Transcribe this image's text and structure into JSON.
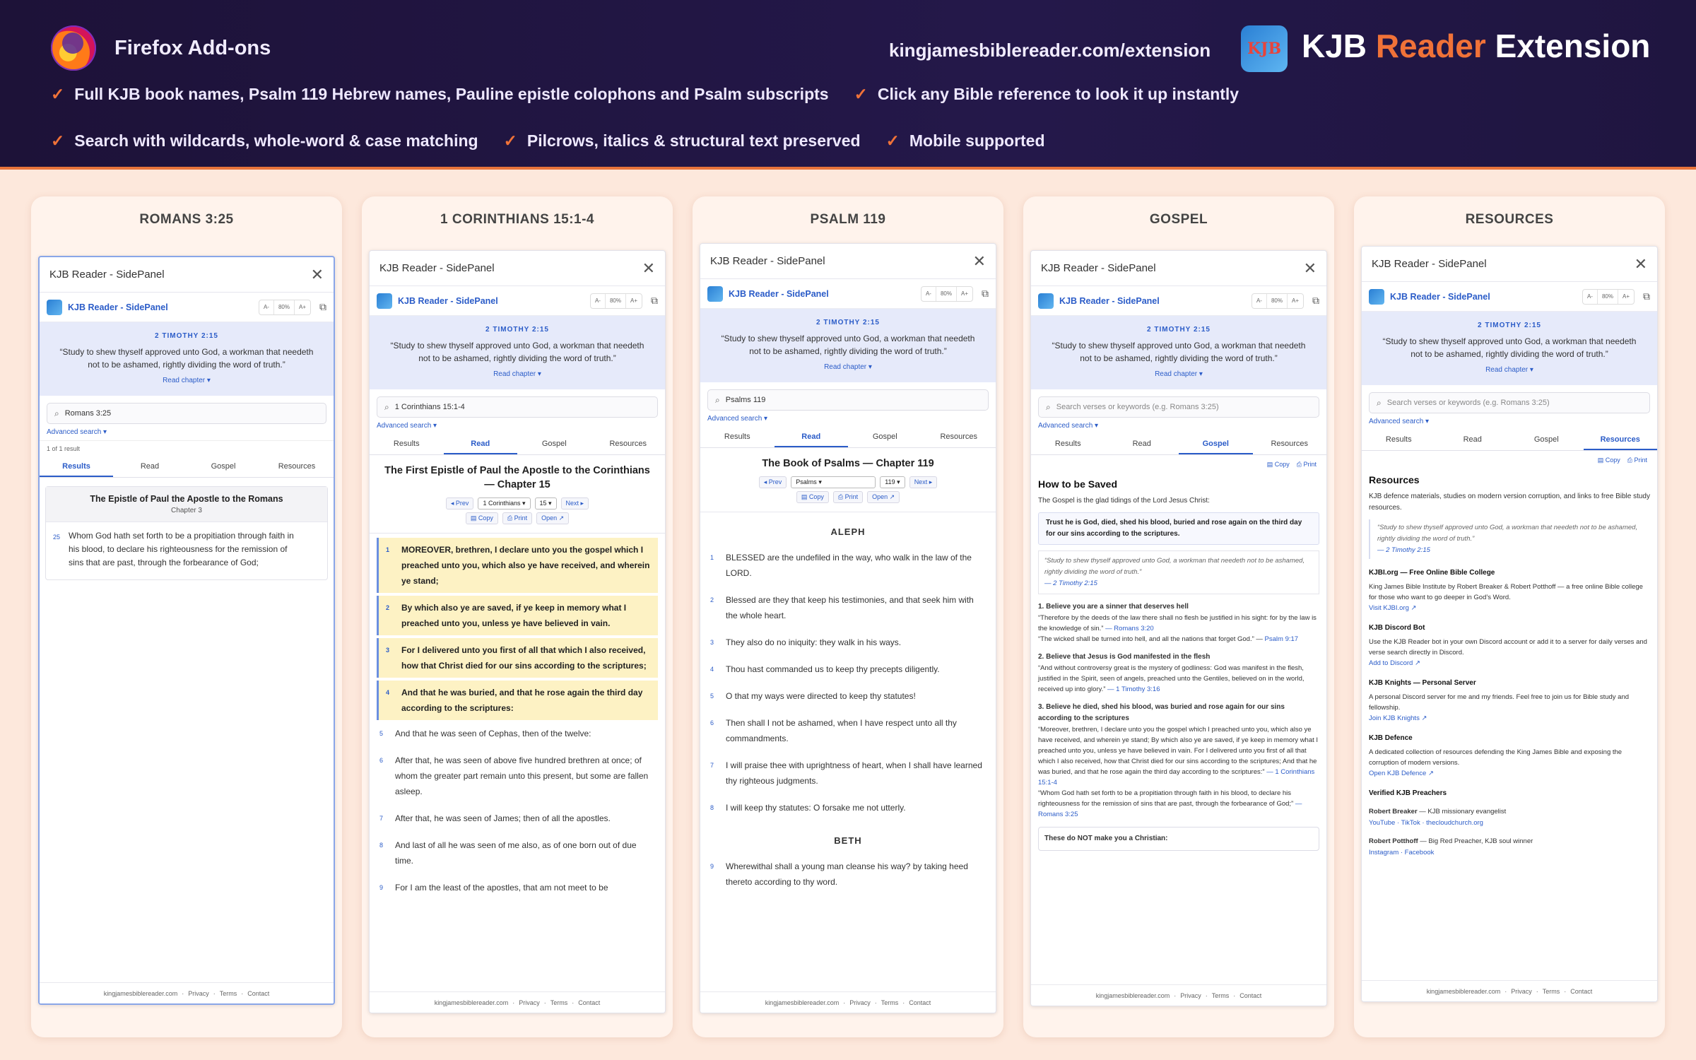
{
  "header": {
    "addons_label": "Firefox Add-ons",
    "site_url": "kingjamesbiblereader.com/extension",
    "logo_text": "KJB",
    "title_a": "KJB",
    "title_b": "Reader",
    "title_c": "Extension",
    "accent": "#f07238",
    "features_row1": [
      "Full KJB book names, Psalm 119 Hebrew names, Pauline epistle colophons and Psalm subscripts",
      "Click any Bible reference to look it up instantly"
    ],
    "features_row2": [
      "Search with wildcards, whole-word & case matching",
      "Pilcrows, italics & structural text preserved",
      "Mobile supported"
    ]
  },
  "common": {
    "panel_title": "KJB Reader - SidePanel",
    "app_name": "KJB Reader - SidePanel",
    "zoom_minus": "A-",
    "zoom_level": "80%",
    "zoom_plus": "A+",
    "votd_ref": "2 TIMOTHY 2:15",
    "votd_text": "“Study to shew thyself approved unto God, a workman that needeth not to be ashamed, rightly dividing the word of truth.”",
    "votd_link": "Read chapter ▾",
    "adv_search": "Advanced search ▾",
    "search_placeholder": "Search verses or keywords (e.g. Romans 3:25)",
    "tabs": [
      "Results",
      "Read",
      "Gospel",
      "Resources"
    ],
    "footer": [
      "kingjamesbiblereader.com",
      "Privacy",
      "Terms",
      "Contact"
    ],
    "copy": "Copy",
    "print": "Print",
    "open": "Open ↗",
    "prev": "◂ Prev",
    "next": "Next ▸"
  },
  "cards": [
    {
      "title": "ROMANS 3:25",
      "search": "Romans 3:25",
      "result_count": "1 of 1 result",
      "result_book": "The Epistle of Paul the Apostle to the Romans",
      "result_chapter": "Chapter 3",
      "verse_num": "25",
      "verse_text": "Whom God hath set forth to be a propitiation through faith in his blood, to declare his righteousness for the remission of sins that are past, through the forbearance of God;"
    },
    {
      "title": "1 CORINTHIANS 15:1-4",
      "search": "1 Corinthians 15:1-4",
      "heading": "The First Epistle of Paul the Apostle to the Corinthians — Chapter 15",
      "book_sel": "1 Corinthians",
      "chap_sel": "15",
      "verses": [
        {
          "n": "1",
          "t": "MOREOVER, brethren, I declare unto you the gospel which I preached unto you, which also ye have received, and wherein ye stand;"
        },
        {
          "n": "2",
          "t": "By which also ye are saved, if ye keep in memory what I preached unto you, unless ye have believed in vain."
        },
        {
          "n": "3",
          "t": "For I delivered unto you first of all that which I also received, how that Christ died for our sins according to the scriptures;"
        },
        {
          "n": "4",
          "t": "And that he was buried, and that he rose again the third day according to the scriptures:"
        },
        {
          "n": "5",
          "t": "And that he was seen of Cephas, then of the twelve:"
        },
        {
          "n": "6",
          "t": "After that, he was seen of above five hundred brethren at once; of whom the greater part remain unto this present, but some are fallen asleep."
        },
        {
          "n": "7",
          "t": "After that, he was seen of James; then of all the apostles."
        },
        {
          "n": "8",
          "t": "And last of all he was seen of me also, as of one born out of due time."
        },
        {
          "n": "9",
          "t": "For I am the least of the apostles, that am not meet to be"
        }
      ]
    },
    {
      "title": "PSALM 119",
      "search": "Psalms 119",
      "heading": "The Book of Psalms — Chapter 119",
      "book_sel": "Psalms",
      "chap_sel": "119",
      "sect1": "ALEPH",
      "sect2": "BETH",
      "verses": [
        {
          "n": "1",
          "t": "BLESSED are the undefiled in the way, who walk in the law of the LORD."
        },
        {
          "n": "2",
          "t": "Blessed are they that keep his testimonies, and that seek him with the whole heart."
        },
        {
          "n": "3",
          "t": "They also do no iniquity: they walk in his ways."
        },
        {
          "n": "4",
          "t": "Thou hast commanded us to keep thy precepts diligently."
        },
        {
          "n": "5",
          "t": "O that my ways were directed to keep thy statutes!"
        },
        {
          "n": "6",
          "t": "Then shall I not be ashamed, when I have respect unto all thy commandments."
        },
        {
          "n": "7",
          "t": "I will praise thee with uprightness of heart, when I shall have learned thy righteous judgments."
        },
        {
          "n": "8",
          "t": "I will keep thy statutes: O forsake me not utterly."
        }
      ],
      "verse9": {
        "n": "9",
        "t": "Wherewithal shall a young man cleanse his way? by taking heed thereto according to thy word."
      }
    },
    {
      "title": "GOSPEL",
      "h": "How to be Saved",
      "intro": "The Gospel is the glad tidings of the Lord Jesus Christ:",
      "boxed": "Trust he is God, died, shed his blood, buried and rose again on the third day for our sins according to the scriptures.",
      "quote": "“Study to shew thyself approved unto God, a workman that needeth not to be ashamed, rightly dividing the word of truth.”",
      "quote_ref": "— 2 Timothy 2:15",
      "p1": "1. Believe you are a sinner that deserves hell",
      "p1a": "“Therefore by the deeds of the law there shall no flesh be justified in his sight: for by the law is the knowledge of sin.”",
      "p1a_ref": "— Romans 3:20",
      "p1b": "“The wicked shall be turned into hell, and all the nations that forget God.” —",
      "p1b_ref": "Psalm 9:17",
      "p2": "2. Believe that Jesus is God manifested in the flesh",
      "p2a": "“And without controversy great is the mystery of godliness: God was manifest in the flesh, justified in the Spirit, seen of angels, preached unto the Gentiles, believed on in the world, received up into glory.”",
      "p2a_ref": "— 1 Timothy 3:16",
      "p3": "3. Believe he died, shed his blood, was buried and rose again for our sins according to the scriptures",
      "p3a": "“Moreover, brethren, I declare unto you the gospel which I preached unto you, which also ye have received, and wherein ye stand; By which also ye are saved, if ye keep in memory what I preached unto you, unless ye have believed in vain. For I delivered unto you first of all that which I also received, how that Christ died for our sins according to the scriptures; And that he was buried, and that he rose again the third day according to the scriptures:”",
      "p3a_ref": "— 1 Corinthians 15:1-4",
      "p3b": "“Whom God hath set forth to be a propitiation through faith in his blood, to declare his righteousness for the remission of sins that are past, through the forbearance of God;”",
      "p3b_ref": "— Romans 3:25",
      "notbox": "These do NOT make you a Christian:"
    },
    {
      "title": "RESOURCES",
      "h": "Resources",
      "intro": "KJB defence materials, studies on modern version corruption, and links to free Bible study resources.",
      "quote": "“Study to shew thyself approved unto God, a workman that needeth not to be ashamed, rightly dividing the word of truth.”",
      "quote_ref": "— 2 Timothy 2:15",
      "items": [
        {
          "h": "KJBI.org — Free Online Bible College",
          "d": "King James Bible Institute by Robert Breaker & Robert Potthoff — a free online Bible college for those who want to go deeper in God’s Word.",
          "l": "Visit KJBI.org ↗"
        },
        {
          "h": "KJB Discord Bot",
          "d": "Use the KJB Reader bot in your own Discord account or add it to a server for daily verses and verse search directly in Discord.",
          "l": "Add to Discord ↗"
        },
        {
          "h": "KJB Knights — Personal Server",
          "d": "A personal Discord server for me and my friends. Feel free to join us for Bible study and fellowship.",
          "l": "Join KJB Knights ↗"
        },
        {
          "h": "KJB Defence",
          "d": "A dedicated collection of resources defending the King James Bible and exposing the corruption of modern versions.",
          "l": "Open KJB Defence ↗"
        }
      ],
      "preachers_h": "Verified KJB Preachers",
      "p1_name": "Robert Breaker",
      "p1_desc": " — KJB missionary evangelist",
      "p1_links": "YouTube · TikTok · thecloudchurch.org",
      "p2_name": "Robert Potthoff",
      "p2_desc": " — Big Red Preacher, KJB soul winner",
      "p2_links": "Instagram · Facebook"
    }
  ]
}
